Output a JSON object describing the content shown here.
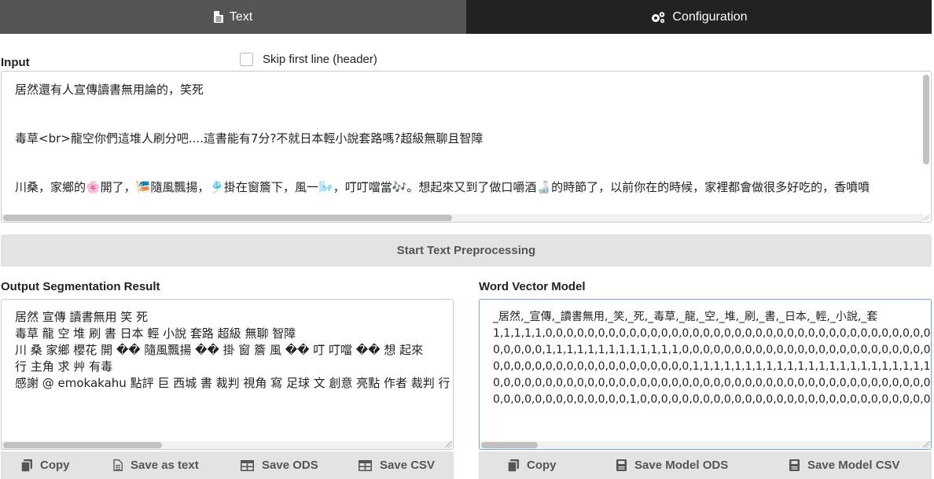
{
  "tabs": [
    {
      "label": "Text",
      "icon": "file-icon",
      "active": true
    },
    {
      "label": "Configuration",
      "icon": "gears-icon",
      "active": false
    }
  ],
  "input": {
    "label": "Input",
    "skip_header_label": "Skip first line (header)",
    "skip_header_checked": false,
    "lines": [
      "居然還有人宣傳讀書無用論的，笑死",
      "毒草<br>龍空你們這堆人刷分吧....這書能有7分?不就日本輕小說套路嗎?超級無聊且智障",
      "川桑，家鄉的🌸開了，🎏隨風飄揚，🎐掛在窗簷下，風一🌬️，叮叮噹當🎶。想起來又到了做口嚼酒🍶的時節了，以前你在的時候，家裡都會做很多好吃的，香噴噴"
    ]
  },
  "preprocess_button": "Start Text Preprocessing",
  "output": {
    "label": "Output Segmentation Result",
    "lines": [
      "居然 宣傳 讀書無用 笑 死",
      "毒草 龍 空 堆 刷 書 日本 輕 小說 套路 超級 無聊 智障",
      "川 桑 家鄉 櫻花 開 �� 隨風飄揚 �� 掛 窗 簷 風 �� 叮 叮噹 �� 想 起來",
      "行 主角 求 艸 有毒",
      "感謝 @ emokakahu 點評 巨 西城 書 裁判 視角 寫 足球 文 創意 亮點 作者 裁判 行"
    ],
    "buttons": [
      {
        "label": "Copy",
        "icon": "copy-icon"
      },
      {
        "label": "Save as text",
        "icon": "file-text-icon"
      },
      {
        "label": "Save ODS",
        "icon": "table-icon"
      },
      {
        "label": "Save CSV",
        "icon": "table-icon"
      }
    ]
  },
  "vector": {
    "label": "Word Vector Model",
    "lines": [
      "_居然,_宣傳,_讀書無用,_笑,_死,_毒草,_龍,_空,_堆,_刷,_書,_日本,_輕,_小說,_套",
      "1,1,1,1,1,0,0,0,0,0,0,0,0,0,0,0,0,0,0,0,0,0,0,0,0,0,0,0,0,0,0,0,0,0,0,0,0,0,0,0,0,0,0,0,0",
      "0,0,0,0,0,1,1,1,1,1,1,1,1,1,1,1,1,1,0,0,0,0,0,0,0,0,0,0,0,0,0,0,0,0,0,0,0,0,0,0,0,0,0,0,0",
      "0,0,0,0,0,0,0,0,0,0,0,0,0,0,0,0,0,0,0,1,1,1,1,1,1,1,1,1,1,1,1,1,1,1,1,1,1,1,1,1,1,1,1,1,1",
      "0,0,0,0,0,0,0,0,0,0,0,0,0,0,0,0,0,0,0,0,0,0,0,0,0,0,0,0,0,0,0,0,0,0,0,0,0,0,0,0,0,0,0,0,0",
      "0,0,0,0,0,0,0,0,0,0,0,0,0,1,0,0,0,0,0,0,0,0,0,0,0,0,0,0,0,0,0,0,0,0,0,0,0,0,0,0,0,0,0,0,0"
    ],
    "buttons": [
      {
        "label": "Copy",
        "icon": "copy-icon"
      },
      {
        "label": "Save Model ODS",
        "icon": "save-icon"
      },
      {
        "label": "Save Model CSV",
        "icon": "save-icon"
      }
    ]
  }
}
